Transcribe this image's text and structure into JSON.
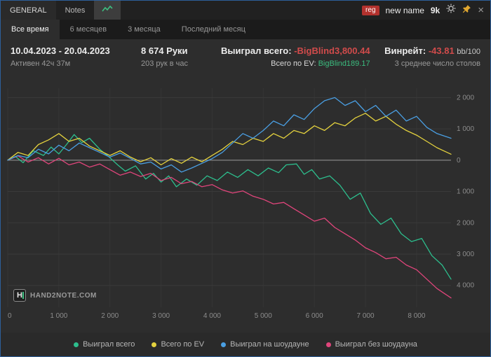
{
  "window": {
    "tabs": [
      {
        "label": "GENERAL"
      },
      {
        "label": "Notes"
      }
    ],
    "badge": "reg",
    "player_name": "new name",
    "stakes": "9k",
    "close_glyph": "×"
  },
  "period_tabs": [
    {
      "label": "Все время",
      "active": true
    },
    {
      "label": "6 месяцев",
      "active": false
    },
    {
      "label": "3 месяца",
      "active": false
    },
    {
      "label": "Последний месяц",
      "active": false
    }
  ],
  "stats": {
    "date_range": "10.04.2023 - 20.04.2023",
    "active_time": "Активен 42ч 37м",
    "hands": "8 674 Руки",
    "hands_per_hour": "203 рук в час",
    "won_label": "Выиграл всего:",
    "won_value": "-BigBlind3,800.44",
    "ev_label": "Всего по EV:",
    "ev_value": "BigBlind189.17",
    "winrate_label": "Винрейт:",
    "winrate_value": "-43.81",
    "winrate_suffix": "bb/100",
    "avg_tables": "3 среднее число столов"
  },
  "logo": {
    "mark": "H",
    "text": "HAND2NOTE.COM"
  },
  "chart_data": {
    "type": "line",
    "title": "",
    "xlabel": "",
    "ylabel": "",
    "xlim": [
      0,
      8674
    ],
    "ylim": [
      -4700,
      2300
    ],
    "grid": true,
    "legend_position": "bottom",
    "x_ticks": [
      0,
      1000,
      2000,
      3000,
      4000,
      5000,
      6000,
      7000,
      8000
    ],
    "x_tick_labels": [
      "0",
      "1 000",
      "2 000",
      "3 000",
      "4 000",
      "5 000",
      "6 000",
      "7 000",
      "8 000"
    ],
    "y_ticks": [
      2000,
      1000,
      0,
      -1000,
      -2000,
      -3000,
      -4000
    ],
    "y_tick_labels": [
      "2 000",
      "1 000",
      "0",
      "1 000",
      "2 000",
      "3 000",
      "4 000"
    ],
    "zero_line_color": "#9a9a9a",
    "grid_color": "#3a3a3a",
    "tick_label_color": "#8c8c8c",
    "series": [
      {
        "name": "Выиграл всего",
        "color": "#2dbe8d",
        "x": [
          0,
          150,
          300,
          500,
          700,
          850,
          1000,
          1150,
          1300,
          1450,
          1600,
          1800,
          2000,
          2150,
          2300,
          2500,
          2700,
          2850,
          3000,
          3150,
          3300,
          3500,
          3700,
          3900,
          4100,
          4300,
          4500,
          4700,
          4900,
          5100,
          5300,
          5450,
          5650,
          5800,
          5950,
          6100,
          6300,
          6500,
          6700,
          6900,
          7100,
          7300,
          7500,
          7700,
          7900,
          8100,
          8300,
          8500,
          8674
        ],
        "y": [
          0,
          120,
          -80,
          300,
          150,
          420,
          200,
          500,
          820,
          560,
          700,
          350,
          80,
          -150,
          -350,
          -180,
          -600,
          -420,
          -700,
          -500,
          -850,
          -600,
          -800,
          -500,
          -650,
          -380,
          -550,
          -300,
          -500,
          -250,
          -400,
          -150,
          -120,
          -450,
          -300,
          -600,
          -500,
          -800,
          -1250,
          -1050,
          -1700,
          -2050,
          -1850,
          -2350,
          -2600,
          -2500,
          -3050,
          -3350,
          -3800
        ]
      },
      {
        "name": "Всего по EV",
        "color": "#e3d13e",
        "x": [
          0,
          200,
          400,
          600,
          800,
          1000,
          1200,
          1400,
          1600,
          1800,
          2000,
          2200,
          2400,
          2600,
          2800,
          3000,
          3200,
          3400,
          3600,
          3800,
          4000,
          4200,
          4400,
          4600,
          4800,
          5000,
          5200,
          5400,
          5600,
          5800,
          6000,
          6200,
          6400,
          6600,
          6800,
          7000,
          7200,
          7400,
          7600,
          7800,
          8000,
          8200,
          8400,
          8674
        ],
        "y": [
          0,
          250,
          150,
          500,
          650,
          850,
          600,
          700,
          450,
          300,
          150,
          300,
          100,
          -50,
          80,
          -150,
          50,
          -100,
          100,
          -50,
          150,
          350,
          600,
          500,
          700,
          600,
          850,
          700,
          950,
          850,
          1100,
          950,
          1200,
          1100,
          1350,
          1500,
          1250,
          1400,
          1150,
          950,
          800,
          600,
          400,
          190
        ]
      },
      {
        "name": "Выиграл на шоудауне",
        "color": "#4a9fe3",
        "x": [
          0,
          200,
          400,
          600,
          800,
          1000,
          1200,
          1400,
          1600,
          1800,
          2000,
          2200,
          2400,
          2600,
          2800,
          3000,
          3200,
          3400,
          3600,
          3800,
          4000,
          4200,
          4400,
          4600,
          4800,
          5000,
          5200,
          5400,
          5600,
          5800,
          6000,
          6200,
          6400,
          6600,
          6800,
          7000,
          7200,
          7400,
          7600,
          7800,
          8000,
          8200,
          8400,
          8674
        ],
        "y": [
          0,
          150,
          80,
          350,
          200,
          480,
          300,
          550,
          400,
          250,
          100,
          230,
          60,
          -120,
          -60,
          -280,
          -150,
          -380,
          -250,
          -100,
          50,
          250,
          550,
          850,
          700,
          950,
          1250,
          1100,
          1450,
          1300,
          1650,
          1900,
          2000,
          1750,
          1900,
          1550,
          1750,
          1400,
          1600,
          1250,
          1400,
          1050,
          850,
          700
        ]
      },
      {
        "name": "Выиграл без шоудауна",
        "color": "#e0457b",
        "x": [
          0,
          200,
          400,
          600,
          800,
          1000,
          1200,
          1400,
          1600,
          1800,
          2000,
          2200,
          2400,
          2600,
          2800,
          3000,
          3200,
          3400,
          3600,
          3800,
          4000,
          4200,
          4400,
          4600,
          4800,
          5000,
          5200,
          5400,
          5600,
          5800,
          6000,
          6200,
          6400,
          6600,
          6800,
          7000,
          7200,
          7400,
          7600,
          7800,
          8000,
          8200,
          8400,
          8674
        ],
        "y": [
          0,
          140,
          -60,
          80,
          -120,
          60,
          -150,
          -60,
          -220,
          -120,
          -300,
          -480,
          -380,
          -520,
          -420,
          -650,
          -550,
          -750,
          -680,
          -850,
          -780,
          -950,
          -1050,
          -980,
          -1150,
          -1250,
          -1400,
          -1350,
          -1550,
          -1750,
          -1950,
          -1850,
          -2150,
          -2350,
          -2550,
          -2800,
          -2950,
          -3150,
          -3100,
          -3350,
          -3500,
          -3800,
          -4100,
          -4400
        ]
      }
    ]
  }
}
